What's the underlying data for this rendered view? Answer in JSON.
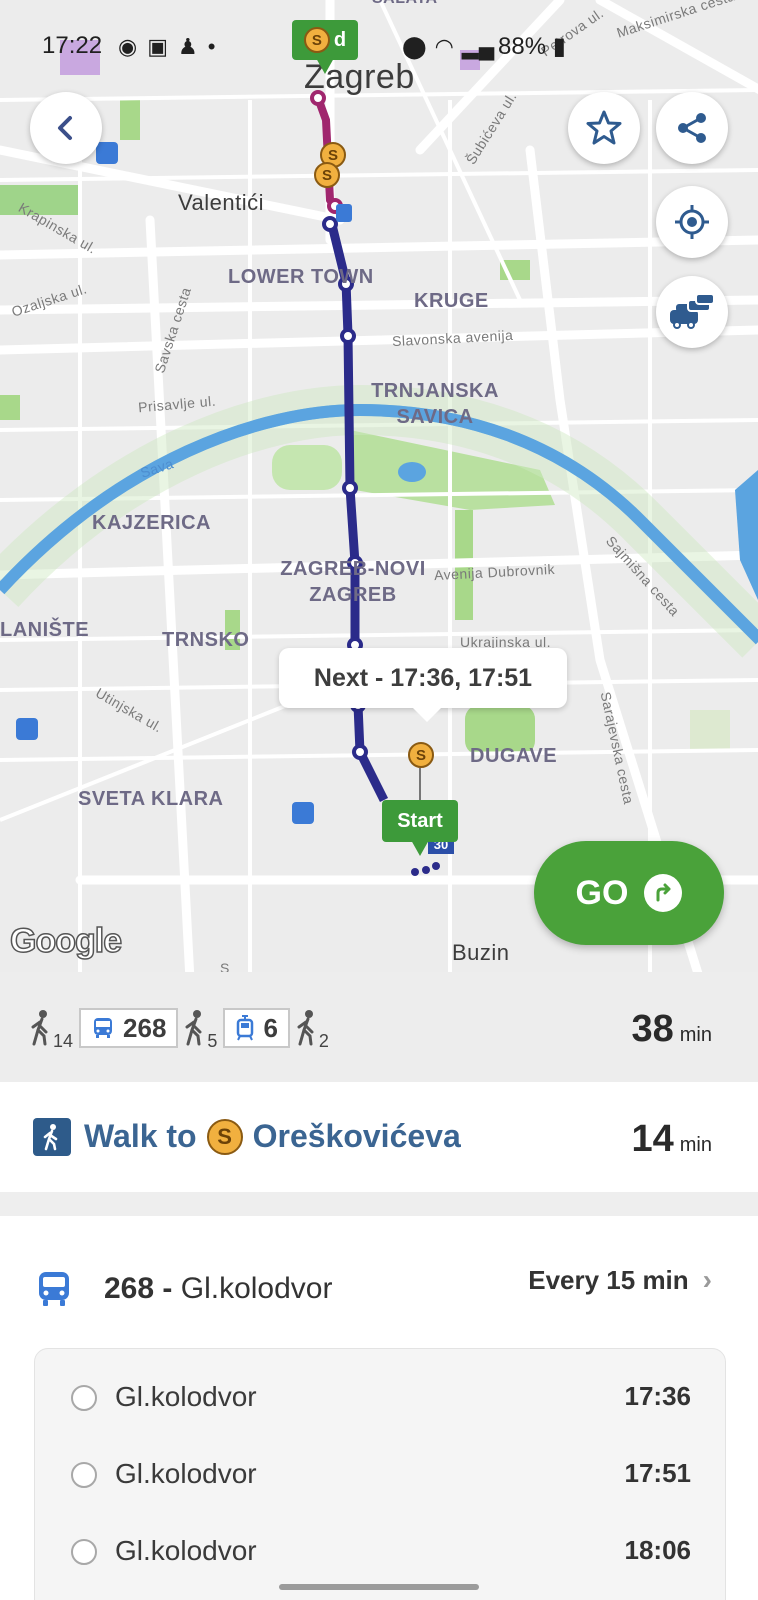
{
  "status_bar": {
    "time": "17:22",
    "battery": "88%"
  },
  "map": {
    "labels": {
      "city": "Zagreb",
      "valentici": "Valentići",
      "lower_town": "LOWER TOWN",
      "kruge": "KRUGE",
      "trnjanska_savica": "TRNJANSKA SAVICA",
      "kajzerica": "KAJZERICA",
      "novi_zagreb": "ZAGREB-NOVI ZAGREB",
      "laniste": "LANIŠTE",
      "trnsko": "TRNSKO",
      "sveta_klara": "SVETA KLARA",
      "dugave": "DUGAVE",
      "buzin": "Buzin",
      "salata": "SALATA",
      "slavonska": "Slavonska avenija",
      "prisavlje": "Prisavlje ul.",
      "sava": "Sava",
      "dubrovnik": "Avenija Dubrovnik",
      "ozaljska": "Ozaljska ul.",
      "krapinska": "Krapinska ul.",
      "savska": "Savska cesta",
      "utinjska": "Utinjska ul.",
      "sajmisna": "Sajmišna cesta",
      "sarajevska": "Sarajevska cesta",
      "ukrajinska": "Ukrajinska ul.",
      "subiceva": "Šubićeva ul.",
      "petrova": "Petrova ul.",
      "maksimirska": "Maksimirska cesta",
      "line_30": "30",
      "street_s": "S"
    },
    "start_flag": "Start",
    "end_flag_letter": "d",
    "stop_badge": "S",
    "tooltip": "Next - 17:36, 17:51",
    "go_label": "GO",
    "google_logo": "Google",
    "route_colors": {
      "bus": "#2b2b8a",
      "tram": "#a0266e",
      "river": "#5ba4e0",
      "park": "#a8d88a"
    }
  },
  "summary": {
    "walk1": "14",
    "bus_line": "268",
    "walk2": "5",
    "tram_line": "6",
    "walk3": "2",
    "total": "38",
    "total_unit": "min"
  },
  "walk_step": {
    "prefix": "Walk to",
    "stop_badge": "S",
    "stop_name": "Oreškovićeva",
    "duration": "14",
    "duration_unit": "min"
  },
  "bus": {
    "line": "268",
    "separator": "-",
    "destination": "Gl.kolodvor",
    "frequency": "Every 15 min",
    "chevron": "›",
    "departures": [
      {
        "stop": "Gl.kolodvor",
        "time": "17:36"
      },
      {
        "stop": "Gl.kolodvor",
        "time": "17:51"
      },
      {
        "stop": "Gl.kolodvor",
        "time": "18:06"
      }
    ]
  }
}
